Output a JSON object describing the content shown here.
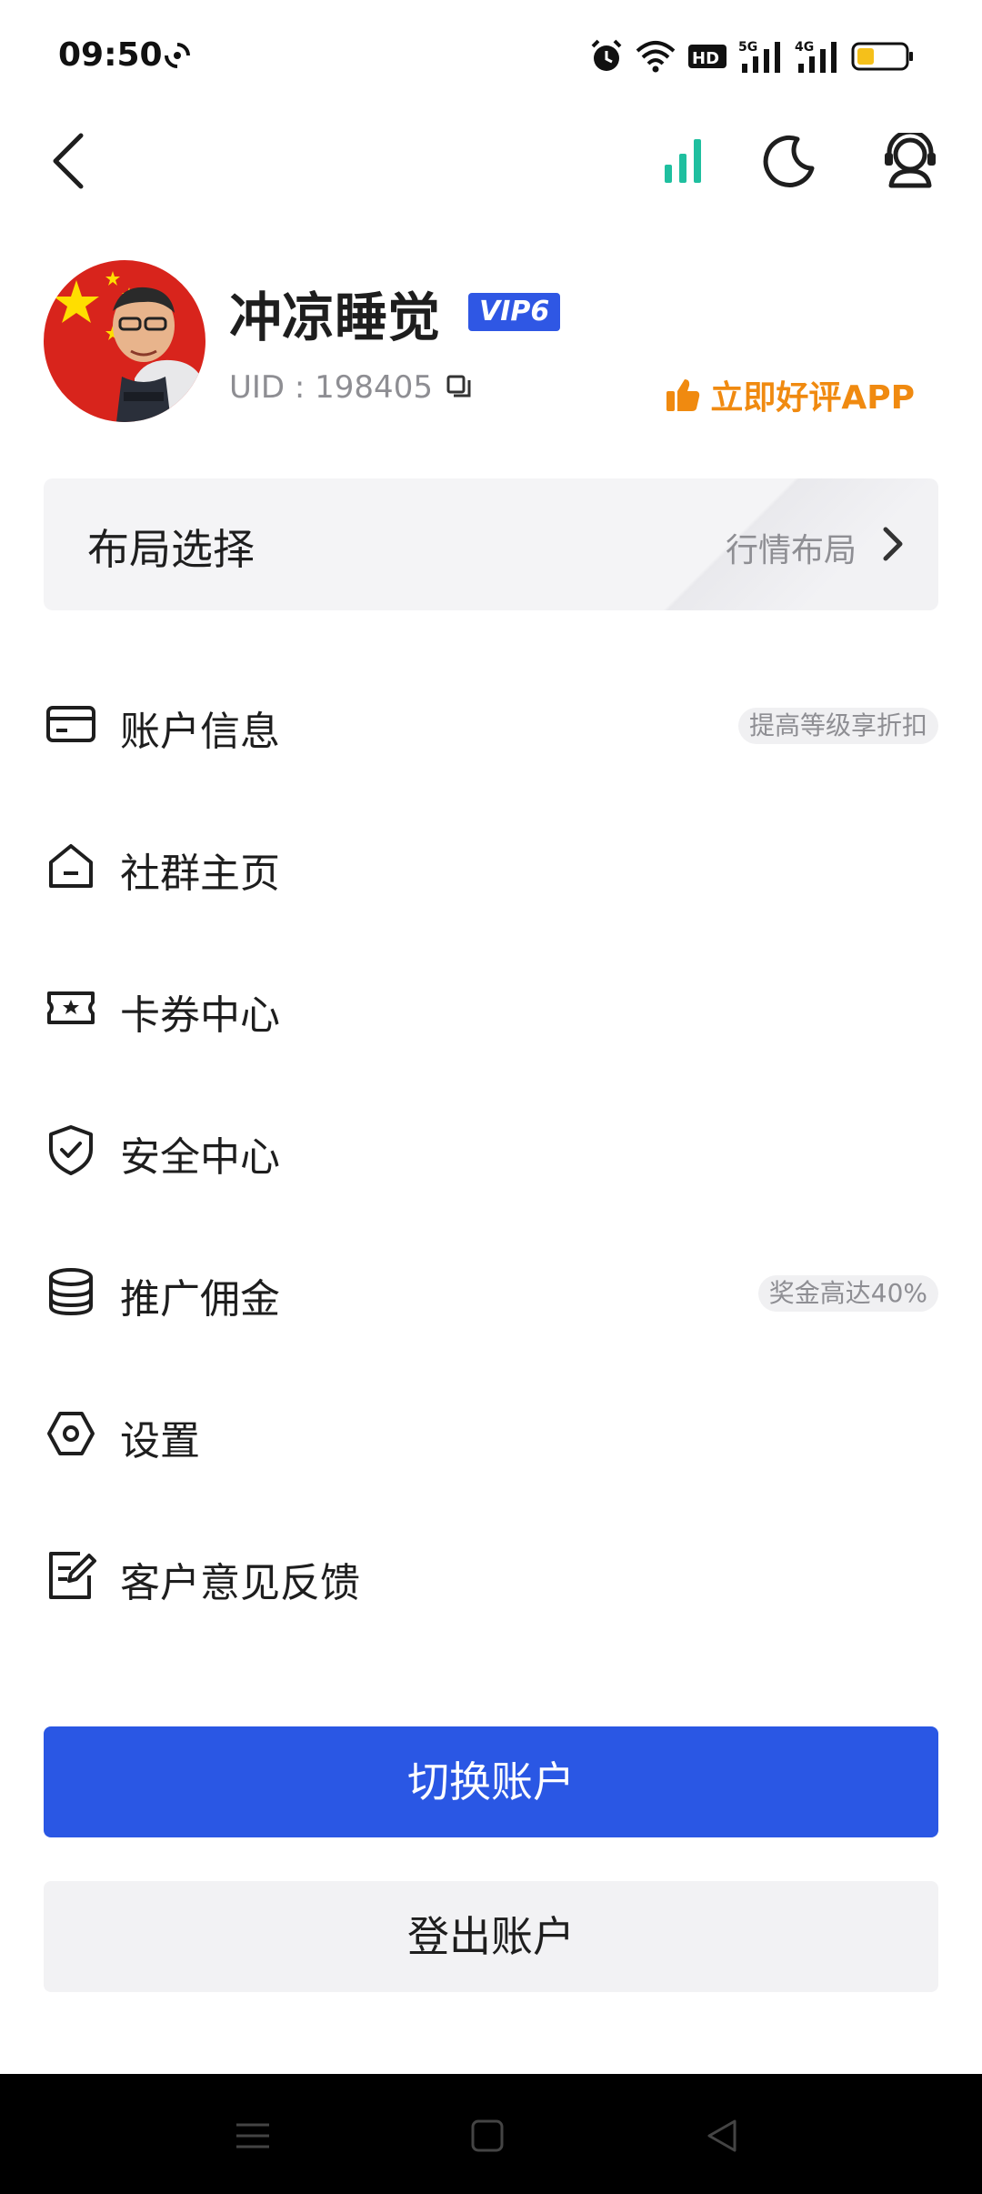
{
  "status_bar": {
    "time": "09:50",
    "icons": [
      "sync-icon",
      "alarm-icon",
      "wifi-icon",
      "hd-icon",
      "signal-5g-icon",
      "signal-4g-icon",
      "battery-icon"
    ],
    "hd_label": "HD",
    "net1_label": "5G",
    "net2_label": "4G"
  },
  "top_bar": {
    "icons": [
      "back-icon",
      "market-signal-icon",
      "moon-icon",
      "support-icon"
    ],
    "accent_color": "#1fbf9f"
  },
  "profile": {
    "username": "冲凉睡觉",
    "vip": "VIP6",
    "uid": "UID : 198405",
    "rate_app": "立即好评APP"
  },
  "layout_card": {
    "title": "布局选择",
    "value": "行情布局"
  },
  "menu": {
    "items": [
      {
        "label": "账户信息",
        "icon": "card-icon",
        "tag": "提高等级享折扣"
      },
      {
        "label": "社群主页",
        "icon": "home-icon"
      },
      {
        "label": "卡券中心",
        "icon": "ticket-icon"
      },
      {
        "label": "安全中心",
        "icon": "shield-icon"
      },
      {
        "label": "推广佣金",
        "icon": "coins-icon",
        "tag": "奖金高达40%"
      },
      {
        "label": "设置",
        "icon": "gear-icon"
      },
      {
        "label": "客户意见反馈",
        "icon": "feedback-icon"
      }
    ]
  },
  "buttons": {
    "switch_account": "切换账户",
    "logout": "登出账户"
  },
  "colors": {
    "primary": "#2a57e4",
    "vip_badge": "#2f57e4",
    "rate_app": "#f08a10"
  },
  "nav_bar": {
    "icons": [
      "menu-icon",
      "home-square-icon",
      "back-triangle-icon"
    ]
  }
}
